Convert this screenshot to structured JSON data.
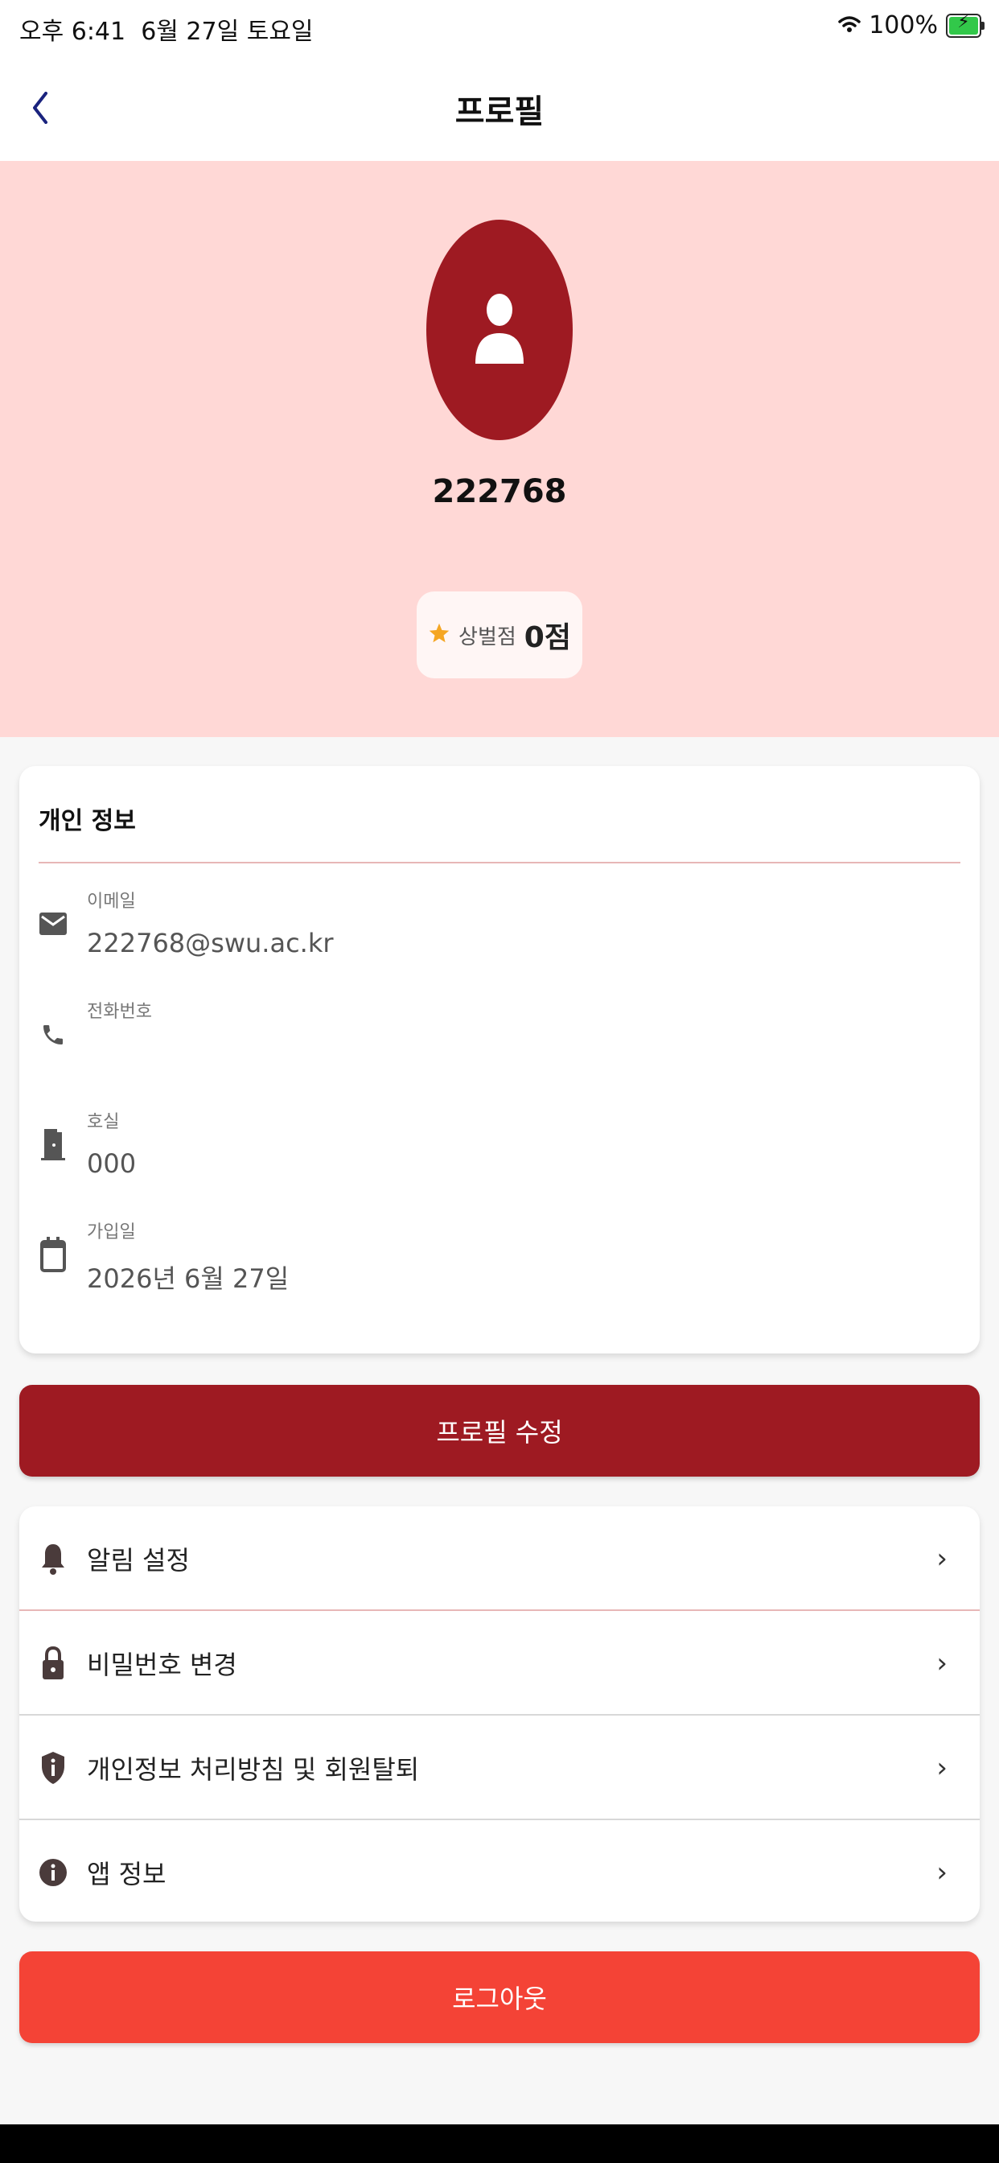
{
  "status_bar": {
    "time": "오후 6:41",
    "date": "6월 27일 토요일",
    "battery": "100%"
  },
  "nav": {
    "title": "프로필",
    "back_icon": "chevron-left-icon"
  },
  "profile": {
    "username": "222768",
    "avatar_icon": "person-icon",
    "points_label": "상벌점",
    "points_value": "0점"
  },
  "personal_info": {
    "title": "개인 정보",
    "fields": [
      {
        "icon": "mail-icon",
        "label": "이메일",
        "value": "222768@swu.ac.kr"
      },
      {
        "icon": "phone-icon",
        "label": "전화번호",
        "value": ""
      },
      {
        "icon": "door-icon",
        "label": "호실",
        "value": "000"
      },
      {
        "icon": "calendar-icon",
        "label": "가입일",
        "value": "2026년 6월 27일"
      }
    ]
  },
  "buttons": {
    "edit_profile": "프로필 수정",
    "logout": "로그아웃"
  },
  "menu": [
    {
      "icon": "bell-icon",
      "label": "알림 설정"
    },
    {
      "icon": "lock-icon",
      "label": "비밀번호 변경"
    },
    {
      "icon": "shield-info-icon",
      "label": "개인정보 처리방침 및 회원탈퇴"
    },
    {
      "icon": "info-icon",
      "label": "앱 정보"
    }
  ],
  "colors": {
    "primary": "#9e1a22",
    "header_bg": "#ffd8d6",
    "logout": "#f44336",
    "star": "#f5a623",
    "back": "#1a237e"
  }
}
